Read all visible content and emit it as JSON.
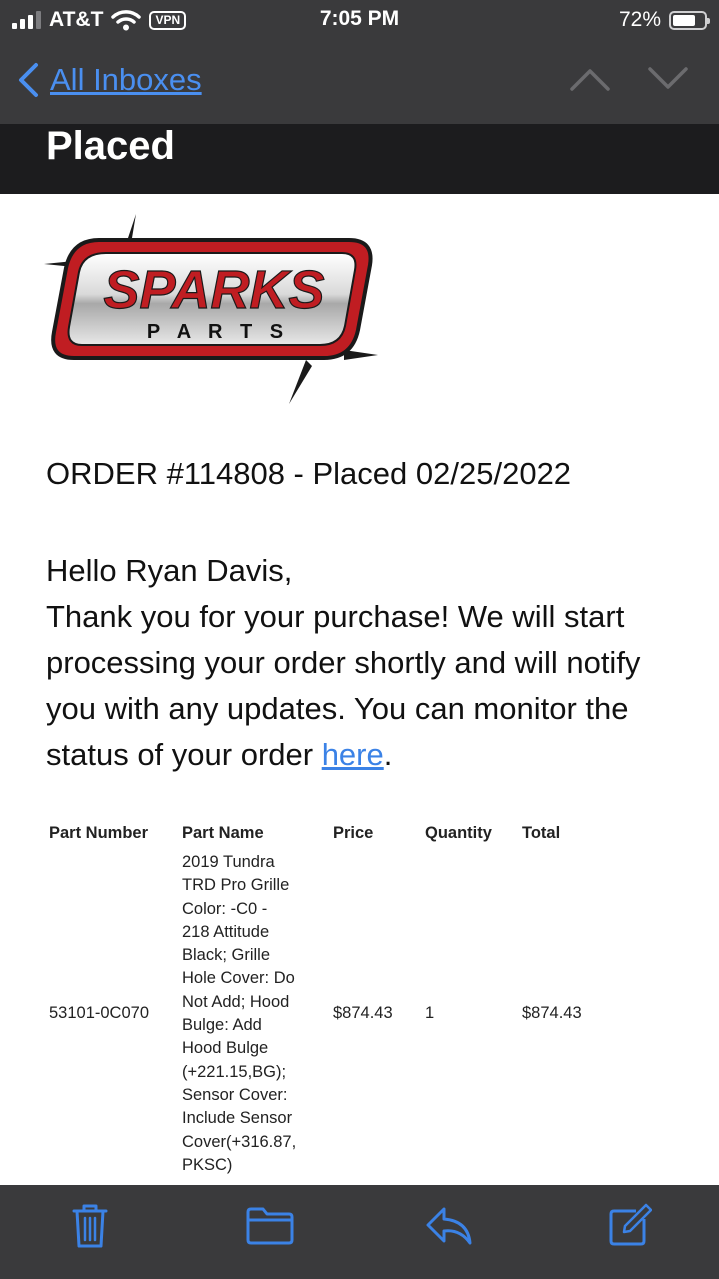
{
  "status_bar": {
    "carrier": "AT&T",
    "vpn_label": "VPN",
    "time": "7:05 PM",
    "battery_percent": "72%",
    "battery_level": 0.72
  },
  "nav": {
    "back_label": "All Inboxes",
    "icons": [
      "chevron-left-icon",
      "chevron-up-icon",
      "chevron-down-icon"
    ]
  },
  "email": {
    "subject_fragment": "Placed",
    "logo": {
      "brand": "SPARKS",
      "sub_brand": "P A R T S"
    },
    "order_title": "ORDER #114808 - Placed 02/25/2022",
    "greeting": "Hello Ryan Davis,",
    "body_prefix": "Thank you for your purchase!  We will start processing your order shortly and will notify you with any updates.  You can monitor the status of your order ",
    "link_text": "here",
    "body_suffix": ".",
    "table": {
      "headers": {
        "part_number": "Part Number",
        "part_name": "Part Name",
        "price": "Price",
        "quantity": "Quantity",
        "total": "Total"
      },
      "rows": [
        {
          "part_number": "53101-0C070",
          "part_name_lines": [
            "2019 Tundra",
            "TRD Pro Grille",
            "Color: -C0 -",
            "218 Attitude",
            "Black; Grille",
            "Hole Cover: Do",
            "Not Add; Hood",
            "Bulge: Add",
            "Hood Bulge",
            "(+221.15,BG);",
            "Sensor Cover:",
            "Include Sensor",
            "Cover(+316.87,",
            "PKSC)"
          ],
          "price": "$874.43",
          "quantity": "1",
          "total": "$874.43"
        }
      ]
    }
  },
  "toolbar": {
    "icons": [
      "trash-icon",
      "folder-icon",
      "reply-icon",
      "compose-icon"
    ],
    "accent_color": "#3b82e6"
  },
  "colors": {
    "link": "#3b82e6",
    "bar_background": "#3a3a3c",
    "subject_background": "#1c1c1e",
    "logo_red": "#c01d22"
  }
}
